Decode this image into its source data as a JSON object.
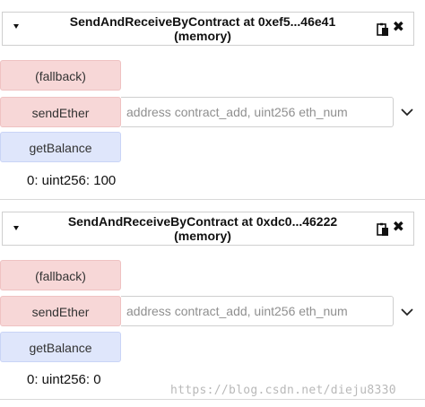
{
  "instances": [
    {
      "title_line1": "SendAndReceiveByContract at 0xef5...46e41",
      "title_line2": "(memory)",
      "functions": [
        {
          "label": "(fallback)"
        },
        {
          "label": "sendEther",
          "placeholder": "address contract_add, uint256 eth_num"
        },
        {
          "label": "getBalance"
        }
      ],
      "result": "0: uint256: 100"
    },
    {
      "title_line1": "SendAndReceiveByContract at 0xdc0...46222",
      "title_line2": "(memory)",
      "functions": [
        {
          "label": "(fallback)"
        },
        {
          "label": "sendEther",
          "placeholder": "address contract_add, uint256 eth_num"
        },
        {
          "label": "getBalance"
        }
      ],
      "result": "0: uint256: 0"
    }
  ],
  "icons": {
    "caret": "caret-down-icon",
    "copy": "clipboard-icon",
    "close": "close-icon",
    "expand": "chevron-down-icon"
  },
  "colors": {
    "transact_button": "#f7d7d7",
    "call_button": "#dfe6fb"
  },
  "watermark": "https://blog.csdn.net/dieju8330"
}
